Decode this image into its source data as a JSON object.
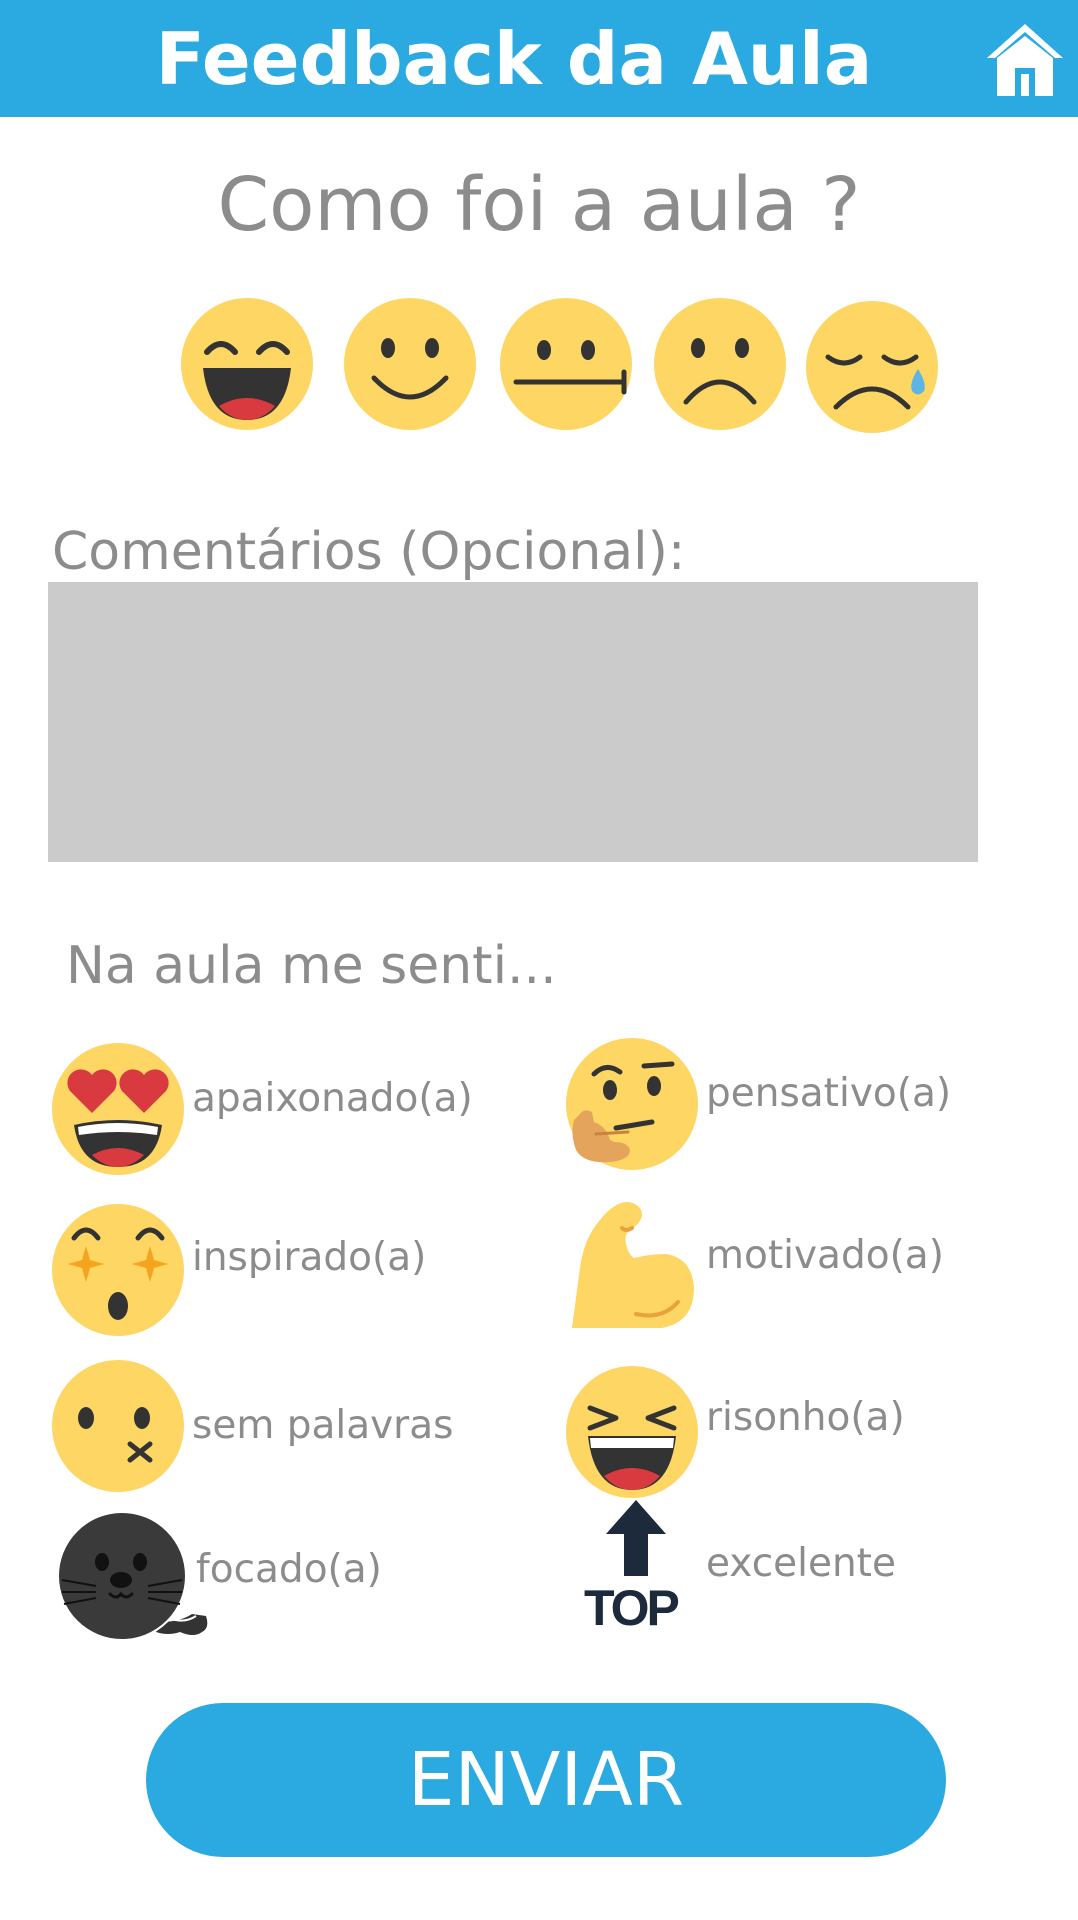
{
  "header": {
    "title": "Feedback da Aula",
    "home_icon": "home-icon"
  },
  "question": "Como foi a aula ?",
  "ratings": [
    {
      "icon": "grinning-face-icon"
    },
    {
      "icon": "smiling-face-icon"
    },
    {
      "icon": "neutral-face-icon"
    },
    {
      "icon": "frowning-face-icon"
    },
    {
      "icon": "crying-face-icon"
    }
  ],
  "comments": {
    "label": "Comentários (Opcional):",
    "value": "",
    "placeholder": ""
  },
  "feelings": {
    "label": "Na aula me senti...",
    "items": [
      {
        "label": "apaixonado(a)",
        "icon": "heart-eyes-icon"
      },
      {
        "label": "pensativo(a)",
        "icon": "thinking-face-icon"
      },
      {
        "label": "inspirado(a)",
        "icon": "star-struck-icon"
      },
      {
        "label": "motivado(a)",
        "icon": "flexed-biceps-icon"
      },
      {
        "label": "sem palavras",
        "icon": "zipped-mouth-icon"
      },
      {
        "label": "risonho(a)",
        "icon": "laughing-face-icon"
      },
      {
        "label": "focado(a)",
        "icon": "seal-icon"
      },
      {
        "label": "excelente",
        "icon": "top-arrow-icon",
        "badge_text": "TOP"
      }
    ]
  },
  "submit": {
    "label": "ENVIAR"
  },
  "colors": {
    "header": "#2aaae1",
    "emoji_face": "#fdd663",
    "text_gray": "#8c8c8c",
    "textarea": "#cbcbcb",
    "button": "#2aaae1"
  }
}
